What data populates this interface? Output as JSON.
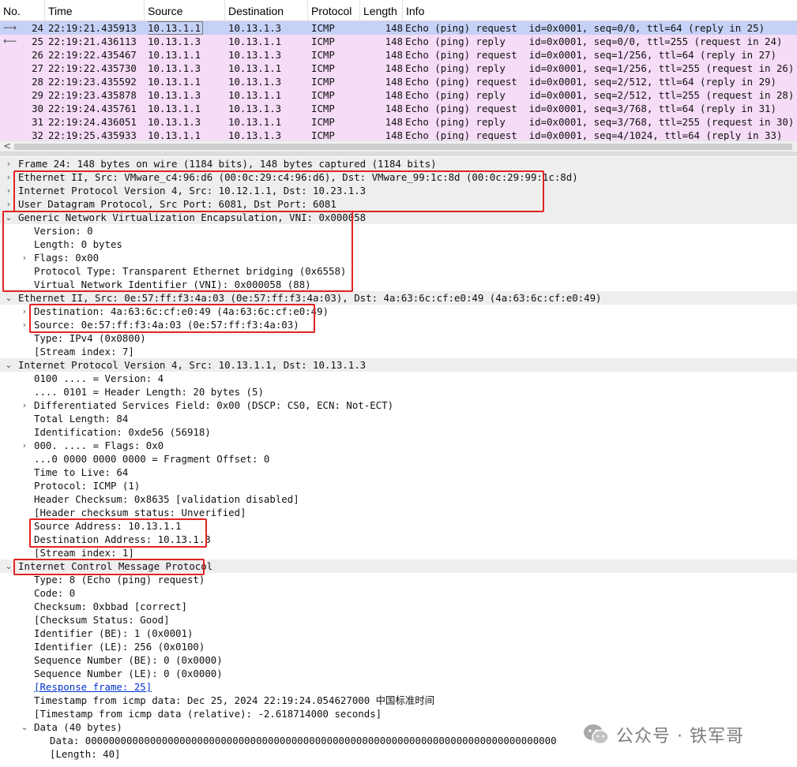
{
  "packet_list": {
    "columns": [
      "No.",
      "Time",
      "Source",
      "Destination",
      "Protocol",
      "Length",
      "Info"
    ],
    "rows": [
      {
        "no": "24",
        "time": "22:19:21.435913",
        "source": "10.13.1.1",
        "destination": "10.13.1.3",
        "protocol": "ICMP",
        "length": "148",
        "info": "Echo (ping) request  id=0x0001, seq=0/0, ttl=64 (reply in 25)",
        "arrow": "⟶",
        "selected": true
      },
      {
        "no": "25",
        "time": "22:19:21.436113",
        "source": "10.13.1.3",
        "destination": "10.13.1.1",
        "protocol": "ICMP",
        "length": "148",
        "info": "Echo (ping) reply    id=0x0001, seq=0/0, ttl=255 (request in 24)",
        "arrow": "⟵",
        "selected": false
      },
      {
        "no": "26",
        "time": "22:19:22.435467",
        "source": "10.13.1.1",
        "destination": "10.13.1.3",
        "protocol": "ICMP",
        "length": "148",
        "info": "Echo (ping) request  id=0x0001, seq=1/256, ttl=64 (reply in 27)",
        "arrow": "",
        "selected": false
      },
      {
        "no": "27",
        "time": "22:19:22.435730",
        "source": "10.13.1.3",
        "destination": "10.13.1.1",
        "protocol": "ICMP",
        "length": "148",
        "info": "Echo (ping) reply    id=0x0001, seq=1/256, ttl=255 (request in 26)",
        "arrow": "",
        "selected": false
      },
      {
        "no": "28",
        "time": "22:19:23.435592",
        "source": "10.13.1.1",
        "destination": "10.13.1.3",
        "protocol": "ICMP",
        "length": "148",
        "info": "Echo (ping) request  id=0x0001, seq=2/512, ttl=64 (reply in 29)",
        "arrow": "",
        "selected": false
      },
      {
        "no": "29",
        "time": "22:19:23.435878",
        "source": "10.13.1.3",
        "destination": "10.13.1.1",
        "protocol": "ICMP",
        "length": "148",
        "info": "Echo (ping) reply    id=0x0001, seq=2/512, ttl=255 (request in 28)",
        "arrow": "",
        "selected": false
      },
      {
        "no": "30",
        "time": "22:19:24.435761",
        "source": "10.13.1.1",
        "destination": "10.13.1.3",
        "protocol": "ICMP",
        "length": "148",
        "info": "Echo (ping) request  id=0x0001, seq=3/768, ttl=64 (reply in 31)",
        "arrow": "",
        "selected": false
      },
      {
        "no": "31",
        "time": "22:19:24.436051",
        "source": "10.13.1.3",
        "destination": "10.13.1.1",
        "protocol": "ICMP",
        "length": "148",
        "info": "Echo (ping) reply    id=0x0001, seq=3/768, ttl=255 (request in 30)",
        "arrow": "",
        "selected": false
      },
      {
        "no": "32",
        "time": "22:19:25.435933",
        "source": "10.13.1.1",
        "destination": "10.13.1.3",
        "protocol": "ICMP",
        "length": "148",
        "info": "Echo (ping) request  id=0x0001, seq=4/1024, ttl=64 (reply in 33)",
        "arrow": "",
        "selected": false
      }
    ]
  },
  "scrollbar": {
    "left_arrow": "<"
  },
  "details": [
    {
      "indent": 0,
      "toggle": "›",
      "header": true,
      "text": "Frame 24: 148 bytes on wire (1184 bits), 148 bytes captured (1184 bits)"
    },
    {
      "indent": 0,
      "toggle": "›",
      "header": true,
      "text": "Ethernet II, Src: VMware_c4:96:d6 (00:0c:29:c4:96:d6), Dst: VMware_99:1c:8d (00:0c:29:99:1c:8d)"
    },
    {
      "indent": 0,
      "toggle": "›",
      "header": true,
      "text": "Internet Protocol Version 4, Src: 10.12.1.1, Dst: 10.23.1.3"
    },
    {
      "indent": 0,
      "toggle": "›",
      "header": true,
      "text": "User Datagram Protocol, Src Port: 6081, Dst Port: 6081"
    },
    {
      "indent": 0,
      "toggle": "⌄",
      "header": true,
      "text": "Generic Network Virtualization Encapsulation, VNI: 0x000058"
    },
    {
      "indent": 1,
      "toggle": "",
      "header": false,
      "text": "Version: 0"
    },
    {
      "indent": 1,
      "toggle": "",
      "header": false,
      "text": "Length: 0 bytes"
    },
    {
      "indent": 1,
      "toggle": "›",
      "header": false,
      "text": "Flags: 0x00"
    },
    {
      "indent": 1,
      "toggle": "",
      "header": false,
      "text": "Protocol Type: Transparent Ethernet bridging (0x6558)"
    },
    {
      "indent": 1,
      "toggle": "",
      "header": false,
      "text": "Virtual Network Identifier (VNI): 0x000058 (88)"
    },
    {
      "indent": 0,
      "toggle": "⌄",
      "header": true,
      "text": "Ethernet II, Src: 0e:57:ff:f3:4a:03 (0e:57:ff:f3:4a:03), Dst: 4a:63:6c:cf:e0:49 (4a:63:6c:cf:e0:49)"
    },
    {
      "indent": 1,
      "toggle": "›",
      "header": false,
      "text": "Destination: 4a:63:6c:cf:e0:49 (4a:63:6c:cf:e0:49)"
    },
    {
      "indent": 1,
      "toggle": "›",
      "header": false,
      "text": "Source: 0e:57:ff:f3:4a:03 (0e:57:ff:f3:4a:03)"
    },
    {
      "indent": 1,
      "toggle": "",
      "header": false,
      "text": "Type: IPv4 (0x0800)"
    },
    {
      "indent": 1,
      "toggle": "",
      "header": false,
      "text": "[Stream index: 7]"
    },
    {
      "indent": 0,
      "toggle": "⌄",
      "header": true,
      "text": "Internet Protocol Version 4, Src: 10.13.1.1, Dst: 10.13.1.3"
    },
    {
      "indent": 1,
      "toggle": "",
      "header": false,
      "text": "0100 .... = Version: 4"
    },
    {
      "indent": 1,
      "toggle": "",
      "header": false,
      "text": ".... 0101 = Header Length: 20 bytes (5)"
    },
    {
      "indent": 1,
      "toggle": "›",
      "header": false,
      "text": "Differentiated Services Field: 0x00 (DSCP: CS0, ECN: Not-ECT)"
    },
    {
      "indent": 1,
      "toggle": "",
      "header": false,
      "text": "Total Length: 84"
    },
    {
      "indent": 1,
      "toggle": "",
      "header": false,
      "text": "Identification: 0xde56 (56918)"
    },
    {
      "indent": 1,
      "toggle": "›",
      "header": false,
      "text": "000. .... = Flags: 0x0"
    },
    {
      "indent": 1,
      "toggle": "",
      "header": false,
      "text": "...0 0000 0000 0000 = Fragment Offset: 0"
    },
    {
      "indent": 1,
      "toggle": "",
      "header": false,
      "text": "Time to Live: 64"
    },
    {
      "indent": 1,
      "toggle": "",
      "header": false,
      "text": "Protocol: ICMP (1)"
    },
    {
      "indent": 1,
      "toggle": "",
      "header": false,
      "text": "Header Checksum: 0x8635 [validation disabled]"
    },
    {
      "indent": 1,
      "toggle": "",
      "header": false,
      "text": "[Header checksum status: Unverified]"
    },
    {
      "indent": 1,
      "toggle": "",
      "header": false,
      "text": "Source Address: 10.13.1.1"
    },
    {
      "indent": 1,
      "toggle": "",
      "header": false,
      "text": "Destination Address: 10.13.1.3"
    },
    {
      "indent": 1,
      "toggle": "",
      "header": false,
      "text": "[Stream index: 1]"
    },
    {
      "indent": 0,
      "toggle": "⌄",
      "header": true,
      "text": "Internet Control Message Protocol"
    },
    {
      "indent": 1,
      "toggle": "",
      "header": false,
      "text": "Type: 8 (Echo (ping) request)"
    },
    {
      "indent": 1,
      "toggle": "",
      "header": false,
      "text": "Code: 0"
    },
    {
      "indent": 1,
      "toggle": "",
      "header": false,
      "text": "Checksum: 0xbbad [correct]"
    },
    {
      "indent": 1,
      "toggle": "",
      "header": false,
      "text": "[Checksum Status: Good]"
    },
    {
      "indent": 1,
      "toggle": "",
      "header": false,
      "text": "Identifier (BE): 1 (0x0001)"
    },
    {
      "indent": 1,
      "toggle": "",
      "header": false,
      "text": "Identifier (LE): 256 (0x0100)"
    },
    {
      "indent": 1,
      "toggle": "",
      "header": false,
      "text": "Sequence Number (BE): 0 (0x0000)"
    },
    {
      "indent": 1,
      "toggle": "",
      "header": false,
      "text": "Sequence Number (LE): 0 (0x0000)"
    },
    {
      "indent": 1,
      "toggle": "",
      "header": false,
      "text": "[Response frame: 25]",
      "link": true
    },
    {
      "indent": 1,
      "toggle": "",
      "header": false,
      "text": "Timestamp from icmp data: Dec 25, 2024 22:19:24.054627000 中国标准时间"
    },
    {
      "indent": 1,
      "toggle": "",
      "header": false,
      "text": "[Timestamp from icmp data (relative): -2.618714000 seconds]"
    },
    {
      "indent": 1,
      "toggle": "⌄",
      "header": false,
      "text": "Data (40 bytes)"
    },
    {
      "indent": 2,
      "toggle": "",
      "header": false,
      "text": "Data: 00000000000000000000000000000000000000000000000000000000000000000000000000000000"
    },
    {
      "indent": 2,
      "toggle": "",
      "header": false,
      "text": "[Length: 40]"
    }
  ],
  "watermark": {
    "text": "公众号 · 铁军哥"
  },
  "colors": {
    "row_bg": "#f6dcf6",
    "selected_row_bg": "#c6d1f7",
    "highlight_box": "#e32222",
    "header_bg": "#eeeeee"
  }
}
